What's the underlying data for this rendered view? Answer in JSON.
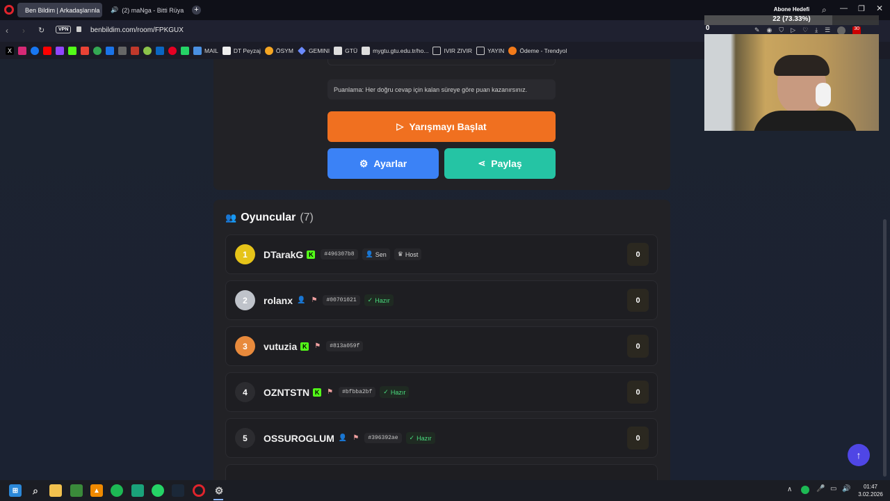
{
  "browser": {
    "tabs": [
      {
        "title": "Ben Bildim | Arkadaşlarınla"
      },
      {
        "title": "(2) maNga - Bitti Rüya"
      }
    ],
    "url": "benbildim.com/room/FPKGUX",
    "vpn_label": "VPN",
    "bookmarks": [
      "MAIL",
      "DT Peyzaj",
      "ÖSYM",
      "GEMINI",
      "GTÜ",
      "mygtu.gtu.edu.tr/ho...",
      "IVIR ZIVIR",
      "YAYIN",
      "Ödeme - Trendyol"
    ]
  },
  "overlay": {
    "title": "Abone Hedefi",
    "progress": "22 (73.33%)",
    "progress_fraction": 0.7333,
    "left_value": "0",
    "badge_count": "30"
  },
  "game": {
    "scoring_text": "Puanlama: Her doğru cevap için kalan süreye göre puan kazanırsınız.",
    "start_button": "Yarışmayı Başlat",
    "settings_button": "Ayarlar",
    "share_button": "Paylaş",
    "players_title": "Oyuncular",
    "players_count": "(7)",
    "players": [
      {
        "rank": "1",
        "name": "DTarakG",
        "kick": true,
        "id": "#496307b8",
        "badges": [
          "Sen",
          "Host"
        ],
        "score": "0",
        "rank_color": "#e6c419"
      },
      {
        "rank": "2",
        "name": "rolanx",
        "kick": false,
        "id": "#00701021",
        "badges": [
          "Hazır"
        ],
        "score": "0",
        "rank_color": "#bfc3ca"
      },
      {
        "rank": "3",
        "name": "vutuzia",
        "kick": true,
        "id": "#813a059f",
        "badges": [],
        "score": "0",
        "rank_color": "#e88a3c"
      },
      {
        "rank": "4",
        "name": "OZNTSTN",
        "kick": true,
        "id": "#bfbba2bf",
        "badges": [
          "Hazır"
        ],
        "score": "0",
        "rank_color": "#2c2c30"
      },
      {
        "rank": "5",
        "name": "OSSUROGLUM",
        "kick": false,
        "id": "#396392ae",
        "badges": [
          "Hazır"
        ],
        "score": "0",
        "rank_color": "#2c2c30"
      }
    ]
  },
  "taskbar": {
    "time": "01:47",
    "date": "3.02.2026"
  },
  "colors": {
    "orange": "#f07020",
    "blue": "#3b82f6",
    "teal": "#25c4a4",
    "scroll_up": "#4f46e5"
  }
}
